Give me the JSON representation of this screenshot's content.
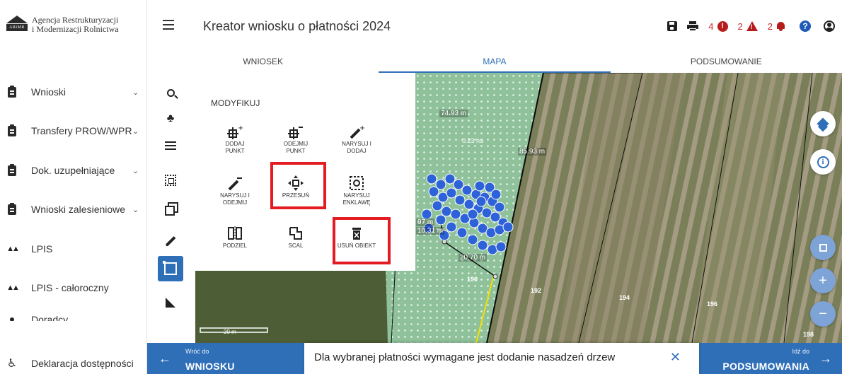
{
  "brand": {
    "logo_text": "ARiMR",
    "line1": "Agencja Restrukturyzacji",
    "line2": "i Modernizacji Rolnictwa"
  },
  "sidebar": {
    "items": [
      {
        "label": "Wnioski",
        "icon": "clipboard-icon",
        "chevron": "⌄"
      },
      {
        "label": "Transfery PROW/WPR",
        "icon": "clipboard-icon",
        "chevron": "⌄"
      },
      {
        "label": "Dok. uzupełniające",
        "icon": "clipboard-icon",
        "chevron": "⌄"
      },
      {
        "label": "Wnioski zalesieniowe",
        "icon": "clipboard-icon",
        "chevron": "⌄"
      },
      {
        "label": "LPIS",
        "icon": "mountain-icon"
      },
      {
        "label": "LPIS - całoroczny",
        "icon": "mountain-icon"
      },
      {
        "label": "Doradcy",
        "icon": "person-icon"
      },
      {
        "label": "Deklaracja dostępności",
        "icon": "accessibility-icon"
      }
    ]
  },
  "header": {
    "title": "Kreator wniosku o płatności 2024",
    "errors_count": "4",
    "warnings_count": "2",
    "notifications_count": "2"
  },
  "tabs": [
    {
      "label": "WNIOSEK",
      "active": false
    },
    {
      "label": "MAPA",
      "active": true
    },
    {
      "label": "PODSUMOWANIE",
      "active": false
    }
  ],
  "modify": {
    "title": "MODYFIKUJ",
    "tools": [
      {
        "label1": "DODAJ",
        "label2": "PUNKT"
      },
      {
        "label1": "ODEJMIJ",
        "label2": "PUNKT"
      },
      {
        "label1": "NARYSUJ I",
        "label2": "DODAJ"
      },
      {
        "label1": "NARYSUJ I",
        "label2": "ODEJMIJ"
      },
      {
        "label1": "PRZESUŃ",
        "label2": ""
      },
      {
        "label1": "NARYSUJ",
        "label2": "ENKLAWĘ"
      },
      {
        "label1": "PODZIEL",
        "label2": ""
      },
      {
        "label1": "SCAL",
        "label2": ""
      },
      {
        "label1": "USUŃ OBIEKT",
        "label2": ""
      }
    ]
  },
  "map": {
    "measure_1": "74.93 m",
    "measure_2": "85.93 m",
    "measure_3": "10.31 m",
    "measure_4": "20.70 m",
    "measure_5": "97 m",
    "area": "0.23 ha",
    "parcel_190": "190",
    "parcel_192": "192",
    "parcel_194": "194",
    "parcel_196": "196",
    "parcel_198": "198",
    "scale": "20 m"
  },
  "bottom": {
    "back_small": "Wróć do",
    "back_big": "WNIOSKU",
    "next_small": "Idź do",
    "next_big": "PODSUMOWANIA",
    "toast": "Dla wybranej płatności wymagane jest dodanie nasadzeń drzew"
  },
  "colors": {
    "accent": "#2f6fb8",
    "error": "#b71c1c",
    "highlight": "#e31c24",
    "pin": "#2e62d9"
  }
}
